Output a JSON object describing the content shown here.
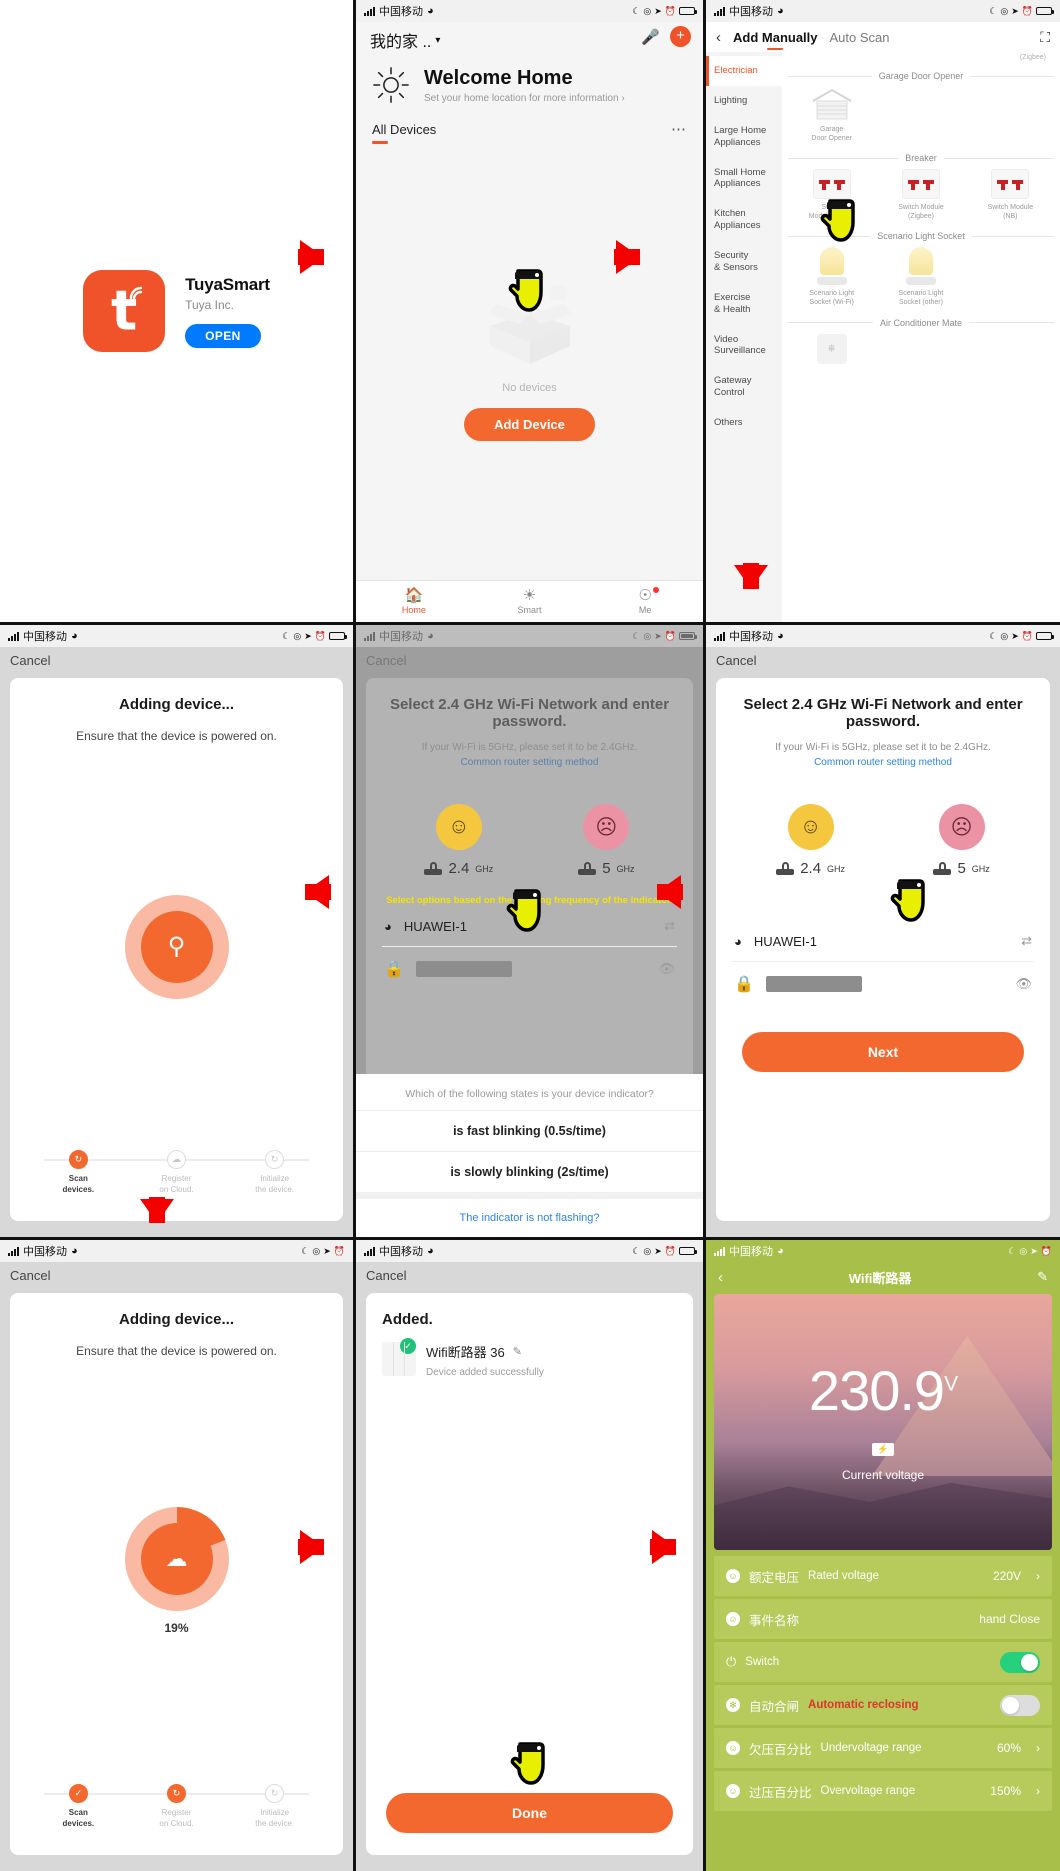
{
  "statusbar": {
    "carrier": "中国移动"
  },
  "panel_appstore": {
    "app_name": "TuyaSmart",
    "developer": "Tuya Inc.",
    "open_label": "OPEN",
    "icon_letter": "t"
  },
  "panel_home": {
    "home_name": "我的家 ..",
    "welcome_title": "Welcome Home",
    "welcome_subtitle": "Set your home location for more information  ›",
    "tab_label": "All Devices",
    "empty_text": "No devices",
    "add_device_button": "Add Device",
    "tabbar": [
      {
        "label": "Home",
        "icon": "home-icon"
      },
      {
        "label": "Smart",
        "icon": "sun-icon"
      },
      {
        "label": "Me",
        "icon": "account-icon"
      }
    ]
  },
  "panel_add_manually": {
    "tab_manual": "Add Manually",
    "tab_autoscan": "Auto Scan",
    "zigbee_note": "(Zigbee)",
    "categories": [
      "Electrician",
      "Lighting",
      "Large Home\nAppliances",
      "Small Home\nAppliances",
      "Kitchen\nAppliances",
      "Security\n& Sensors",
      "Exercise\n& Health",
      "Video\nSurveillance",
      "Gateway\nControl",
      "Others"
    ],
    "active_category": "Electrician",
    "sections": [
      {
        "title": "Garage Door Opener",
        "items": [
          {
            "name": "Garage\nDoor Opener",
            "type": "garage"
          }
        ]
      },
      {
        "title": "Breaker",
        "items": [
          {
            "name": "Switch\nModule  (Wi-Fi)",
            "type": "switch"
          },
          {
            "name": "Switch Module\n(Zigbee)",
            "type": "switch"
          },
          {
            "name": "Switch Module\n(NB)",
            "type": "switch"
          }
        ]
      },
      {
        "title": "Scenario Light Socket",
        "items": [
          {
            "name": "Scenario Light\nSocket (Wi-Fi)",
            "type": "lamp"
          },
          {
            "name": "Scenario Light\nSocket (other)",
            "type": "lamp"
          }
        ]
      },
      {
        "title": "Air Conditioner Mate",
        "items": [
          {
            "name": "",
            "type": "acmate"
          }
        ]
      }
    ]
  },
  "panel_adding_scan": {
    "cancel": "Cancel",
    "title": "Adding device...",
    "subtitle": "Ensure that the device is powered on.",
    "steps": [
      {
        "label": "Scan\ndevices.",
        "state": "active"
      },
      {
        "label": "Register\non Cloud.",
        "state": "pending"
      },
      {
        "label": "Initialize\nthe device.",
        "state": "pending"
      }
    ]
  },
  "panel_wifi_dim": {
    "cancel": "Cancel",
    "title": "Select 2.4 GHz Wi-Fi Network and enter password.",
    "hint": "If your Wi-Fi is 5GHz, please set it to be 2.4GHz.",
    "link": "Common router setting method",
    "band_ok": "2.4",
    "band_ok_unit": "GHz",
    "band_bad": "5",
    "band_bad_unit": "GHz",
    "warning": "Select options based on the blinking frequency of the indicator.",
    "ssid": "HUAWEI-1",
    "sheet": {
      "question": "Which of the following states is your device indicator?",
      "option_fast": "is fast blinking  (0.5s/time)",
      "option_slow": "is slowly blinking  (2s/time)",
      "not_flashing": "The indicator is not flashing?"
    }
  },
  "panel_wifi": {
    "cancel": "Cancel",
    "title": "Select 2.4 GHz Wi-Fi Network and enter password.",
    "hint": "If your Wi-Fi is 5GHz, please set it to be 2.4GHz.",
    "link": "Common router setting method",
    "band_ok": "2.4",
    "band_ok_unit": "GHz",
    "band_bad": "5",
    "band_bad_unit": "GHz",
    "ssid": "HUAWEI-1",
    "password_value": "",
    "next_button": "Next"
  },
  "panel_adding_progress": {
    "cancel": "Cancel",
    "title": "Adding device...",
    "subtitle": "Ensure that the device is powered on.",
    "percent": "19%",
    "percent_value": 19,
    "steps": [
      {
        "label": "Scan\ndevices.",
        "state": "done"
      },
      {
        "label": "Register\non Cloud.",
        "state": "active"
      },
      {
        "label": "Initialize\nthe device.",
        "state": "pending"
      }
    ]
  },
  "panel_added": {
    "cancel": "Cancel",
    "title": "Added.",
    "device_name": "Wifi断路器 36",
    "status": "Device added successfully",
    "done_button": "Done"
  },
  "panel_device": {
    "nav_title": "Wifi断路器",
    "voltage_value": "230.9",
    "voltage_unit": "V",
    "voltage_label": "Current voltage",
    "rows": [
      {
        "cn": "额定电压",
        "en": "Rated voltage",
        "value": "220V",
        "control": "chevron",
        "en_style": "normal"
      },
      {
        "cn": "事件名称",
        "en": "",
        "value": "hand Close",
        "control": "none",
        "en_style": "normal"
      },
      {
        "cn": "",
        "en": "Switch",
        "value": "",
        "control": "toggle-on",
        "en_style": "normal"
      },
      {
        "cn": "自动合闸",
        "en": "Automatic reclosing",
        "value": "",
        "control": "toggle-off",
        "en_style": "red"
      },
      {
        "cn": "欠压百分比",
        "en": "Undervoltage range",
        "value": "60%",
        "control": "chevron",
        "en_style": "normal"
      },
      {
        "cn": "过压百分比",
        "en": "Overvoltage range",
        "value": "150%",
        "control": "chevron",
        "en_style": "normal"
      }
    ]
  },
  "colors": {
    "accent_orange": "#f2682f",
    "brand_blue": "#007aff",
    "device_green": "#a8bf4a",
    "arrow_red": "#f40000",
    "cursor_yellow": "#e8f000"
  }
}
